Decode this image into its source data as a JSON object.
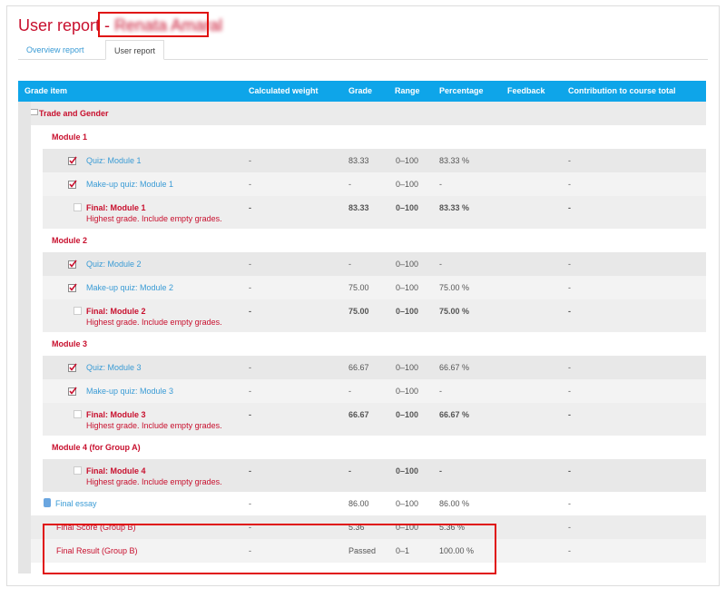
{
  "header": {
    "title": "User report -",
    "user_name": "Renata Amaral"
  },
  "tabs": [
    {
      "label": "Overview report"
    },
    {
      "label": "User report"
    }
  ],
  "columns": [
    "Grade item",
    "Calculated weight",
    "Grade",
    "Range",
    "Percentage",
    "Feedback",
    "Contribution to course total"
  ],
  "category": {
    "label": "Trade and Gender"
  },
  "modules": [
    {
      "heading": "Module 1",
      "items": [
        {
          "name": "Quiz: Module 1",
          "weight": "-",
          "grade": "83.33",
          "range": "0–100",
          "percentage": "83.33 %",
          "contribution": "-"
        },
        {
          "name": "Make-up quiz: Module 1",
          "weight": "-",
          "grade": "-",
          "range": "0–100",
          "percentage": "-",
          "contribution": "-"
        }
      ],
      "final": {
        "name": "Final: Module 1",
        "note": "Highest grade. Include empty grades.",
        "weight": "-",
        "grade": "83.33",
        "range": "0–100",
        "percentage": "83.33 %",
        "contribution": "-"
      }
    },
    {
      "heading": "Module 2",
      "items": [
        {
          "name": "Quiz: Module 2",
          "weight": "-",
          "grade": "-",
          "range": "0–100",
          "percentage": "-",
          "contribution": "-"
        },
        {
          "name": "Make-up quiz: Module 2",
          "weight": "-",
          "grade": "75.00",
          "range": "0–100",
          "percentage": "75.00 %",
          "contribution": "-"
        }
      ],
      "final": {
        "name": "Final: Module 2",
        "note": "Highest grade. Include empty grades.",
        "weight": "-",
        "grade": "75.00",
        "range": "0–100",
        "percentage": "75.00 %",
        "contribution": "-"
      }
    },
    {
      "heading": "Module 3",
      "items": [
        {
          "name": "Quiz: Module 3",
          "weight": "-",
          "grade": "66.67",
          "range": "0–100",
          "percentage": "66.67 %",
          "contribution": "-"
        },
        {
          "name": "Make-up quiz: Module 3",
          "weight": "-",
          "grade": "-",
          "range": "0–100",
          "percentage": "-",
          "contribution": "-"
        }
      ],
      "final": {
        "name": "Final: Module 3",
        "note": "Highest grade. Include empty grades.",
        "weight": "-",
        "grade": "66.67",
        "range": "0–100",
        "percentage": "66.67 %",
        "contribution": "-"
      }
    },
    {
      "heading": "Module 4 (for Group A)",
      "items": [],
      "final": {
        "name": "Final: Module 4",
        "note": "Highest grade. Include empty grades.",
        "weight": "-",
        "grade": "-",
        "range": "0–100",
        "percentage": "-",
        "contribution": "-"
      }
    }
  ],
  "extra_items": [
    {
      "name": "Final essay",
      "weight": "-",
      "grade": "86.00",
      "range": "0–100",
      "percentage": "86.00 %",
      "contribution": "-"
    },
    {
      "name": "Final Score (Group B)",
      "weight": "-",
      "grade": "5.36",
      "range": "0–100",
      "percentage": "5.36 %",
      "contribution": "-"
    },
    {
      "name": "Final Result (Group B)",
      "weight": "-",
      "grade": "Passed",
      "range": "0–1",
      "percentage": "100.00 %",
      "contribution": "-"
    }
  ],
  "colors": {
    "accent": "#0ea5e9",
    "link": "#3a9bd5",
    "red": "#c8102e",
    "highlight_box": "#e01010"
  }
}
